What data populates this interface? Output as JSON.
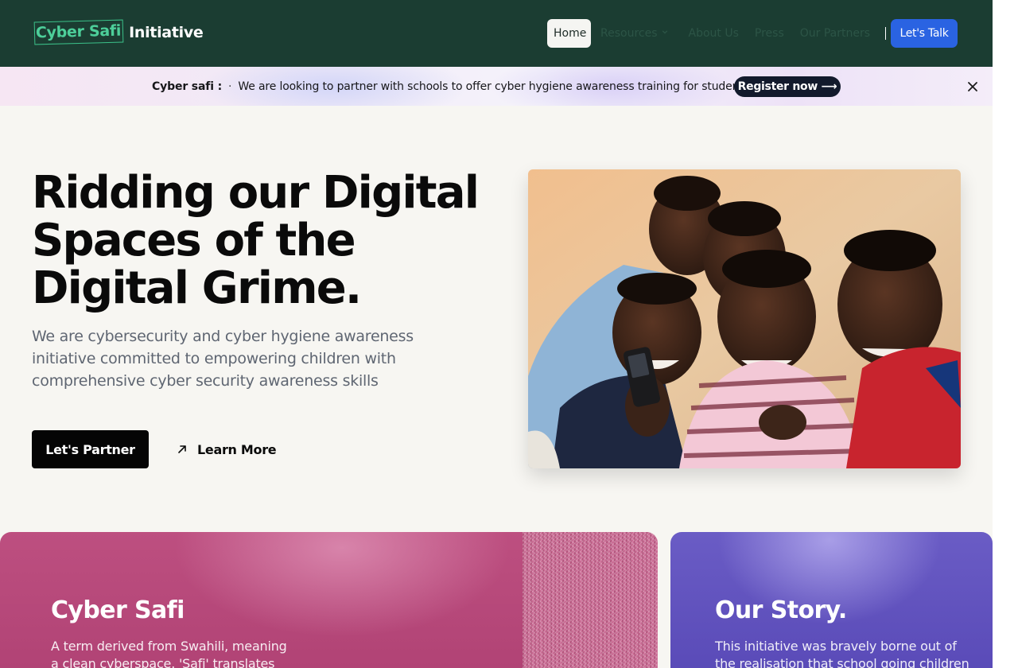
{
  "header": {
    "logo_box": "Cyber Safi",
    "logo_rest": "Initiative",
    "nav": [
      {
        "label": "Home"
      },
      {
        "label": "Resources"
      },
      {
        "label": "About Us"
      },
      {
        "label": "Press"
      },
      {
        "label": "Our Partners"
      }
    ],
    "cta_label": "Let's Talk"
  },
  "announcement": {
    "brand": "Cyber safi :",
    "separator": "·",
    "message": "We are looking to partner with schools to offer cyber hygiene awareness training for students.",
    "button_label": "Register now ⟶"
  },
  "hero": {
    "title": "Ridding our Digital Spaces of the Digital Grime.",
    "subtitle": "We are cybersecurity and cyber hygiene awareness initiative committed to empowering children with comprehensive cyber security awareness skills",
    "primary_button": "Let's Partner",
    "secondary_button": "Learn More"
  },
  "cards": {
    "left": {
      "title": "Cyber Safi",
      "text": "A term derived from Swahili, meaning a clean cyberspace. 'Safi' translates to"
    },
    "right": {
      "title": "Our Story.",
      "text": "This initiative was bravely borne out of the realisation that school going children"
    }
  },
  "icons": {
    "chevron": "chevron-down-icon",
    "arrow": "arrow-up-right-icon",
    "close": "close-icon"
  },
  "colors": {
    "header_bg": "#1b3d32",
    "logo_green": "#4dcf9a",
    "cta_blue": "#2a63e2",
    "hero_bg": "#f7f6f2",
    "pink_card": "#b84a7b",
    "purple_card": "#6355bf"
  }
}
